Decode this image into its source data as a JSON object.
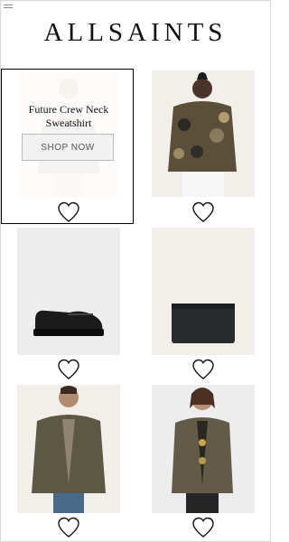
{
  "header": {
    "brand": "ALLSAINTS",
    "menu_icon": "menu-icon"
  },
  "products": [
    {
      "name": "Future Crew Neck Sweatshirt",
      "cta": "SHOP NOW",
      "selected": true,
      "icon": "heart-icon"
    },
    {
      "icon": "heart-icon"
    },
    {
      "icon": "heart-icon"
    },
    {
      "icon": "heart-icon"
    },
    {
      "icon": "heart-icon"
    },
    {
      "icon": "heart-icon"
    }
  ],
  "colors": {
    "brand_text": "#111111",
    "image_bg_light": "#f2efea",
    "image_bg_grey": "#ededed"
  }
}
